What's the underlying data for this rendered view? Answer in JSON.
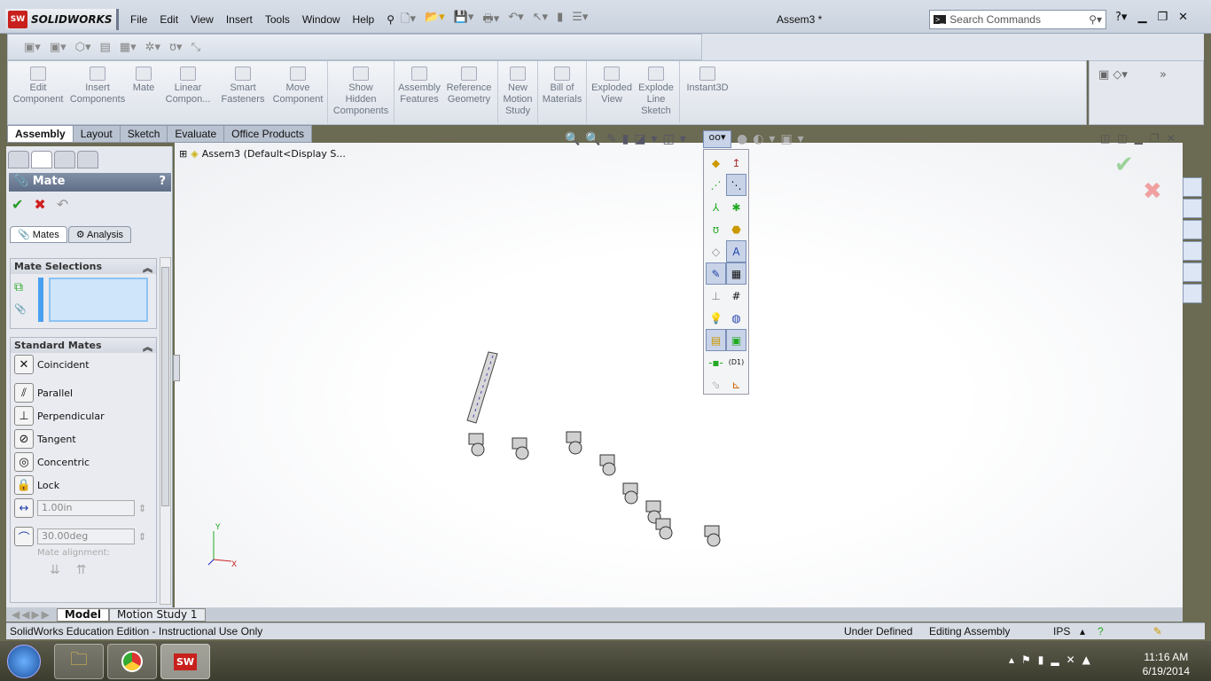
{
  "app": {
    "logo": "SOLIDWORKS",
    "document_title": "Assem3 *"
  },
  "menu": [
    "File",
    "Edit",
    "View",
    "Insert",
    "Tools",
    "Window",
    "Help"
  ],
  "search": {
    "placeholder": "Search Commands"
  },
  "command_manager": [
    {
      "label": "Edit Component"
    },
    {
      "label": "Insert Components"
    },
    {
      "label": "Mate"
    },
    {
      "label": "Linear Compon..."
    },
    {
      "label": "Smart Fasteners"
    },
    {
      "label": "Move Component"
    },
    {
      "label": "Show Hidden Components"
    },
    {
      "label": "Assembly Features"
    },
    {
      "label": "Reference Geometry"
    },
    {
      "label": "New Motion Study"
    },
    {
      "label": "Bill of Materials"
    },
    {
      "label": "Exploded View"
    },
    {
      "label": "Explode Line Sketch"
    },
    {
      "label": "Instant3D"
    }
  ],
  "tabs": [
    "Assembly",
    "Layout",
    "Sketch",
    "Evaluate",
    "Office Products"
  ],
  "feature_tree": {
    "root": "Assem3  (Default<Display S..."
  },
  "property_manager": {
    "title": "Mate",
    "help": "?",
    "subtabs": [
      "Mates",
      "Analysis"
    ],
    "mate_selections": "Mate Selections",
    "standard_mates": "Standard Mates",
    "mates": [
      "Coincident",
      "Parallel",
      "Perpendicular",
      "Tangent",
      "Concentric",
      "Lock"
    ],
    "distance": "1.00in",
    "angle": "30.00deg",
    "alignment_label": "Mate alignment:"
  },
  "bottom_tabs": [
    "Model",
    "Motion Study 1"
  ],
  "status": {
    "edition": "SolidWorks Education Edition - Instructional Use Only",
    "state": "Under Defined",
    "mode": "Editing Assembly",
    "units": "IPS"
  },
  "taskbar": {
    "time": "11:16 AM",
    "date": "6/19/2014"
  },
  "colors": {
    "accent": "#5f6d86",
    "ok": "#2a9a2a",
    "cancel": "#d02020"
  }
}
